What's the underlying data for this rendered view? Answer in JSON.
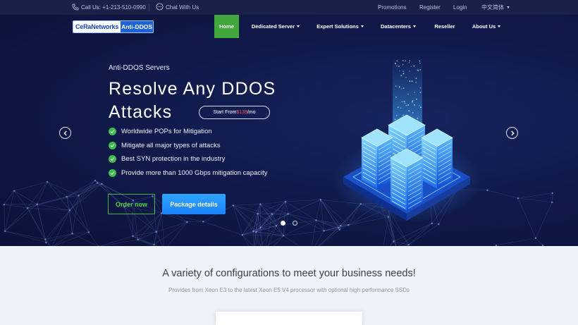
{
  "topbar": {
    "call_label": "Call Us: +1-213-510-0990",
    "chat_label": "Chat With Us",
    "promotions": "Promotions",
    "register": "Register",
    "login": "Login",
    "language": "中文简体"
  },
  "nav": {
    "logo_left": "CeRaNetworks",
    "logo_right": "Anti-DDOS",
    "items": [
      "Home",
      "Dedicated Server",
      "Expert Solutions",
      "Datacenters",
      "Reseller",
      "About Us"
    ]
  },
  "hero": {
    "subtitle": "Anti-DDOS Servers",
    "title_line1": "Resolve Any DDOS",
    "title_line2": "Attacks",
    "price_prefix": "Start From ",
    "price": "$139",
    "price_suffix": "/mo",
    "features": [
      "Worldwide POPs for Mitigation",
      "Mitigate all major types of attacks",
      "Best SYN protection in the industry",
      "Provide more than 1000 Gbps mitigation capacity"
    ],
    "order_btn": "Order now",
    "package_btn": "Package details",
    "active_slide": 1,
    "slide_count": 2
  },
  "section": {
    "title": "A variety of configurations to meet your business needs!",
    "subtitle": "Provides from Xeon E3 to the latest Xeon E5 V4 processor with optional high performance SSDs"
  },
  "colors": {
    "topbar_bg": "#1a2148",
    "hero_bg": "#101a4b",
    "accent_green": "#42a83e",
    "accent_blue": "#1b83ff",
    "price_red": "#ff4e5b"
  }
}
